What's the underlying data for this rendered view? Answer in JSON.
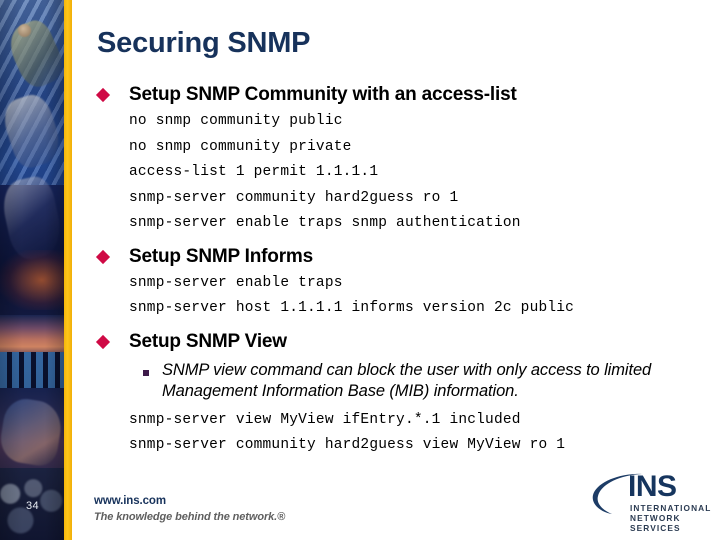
{
  "slide": {
    "title": "Securing SNMP",
    "page_number": "34"
  },
  "colors": {
    "title_navy": "#17325b",
    "bullet_crimson": "#cf0a45",
    "subbullet_purple": "#3d1a4a",
    "gold_stripe": "#ffc61a",
    "logo_navy": "#16355e"
  },
  "sections": [
    {
      "heading": "Setup SNMP Community with an access-list",
      "code": [
        "no snmp community public",
        "no snmp community private",
        "access-list 1 permit 1.1.1.1",
        "snmp-server community hard2guess ro 1",
        "snmp-server enable traps snmp authentication"
      ]
    },
    {
      "heading": "Setup SNMP Informs",
      "code": [
        "snmp-server enable traps",
        "snmp-server host 1.1.1.1 informs version 2c public"
      ]
    },
    {
      "heading": "Setup SNMP View",
      "subbullet": "SNMP view command can block the user with only access to limited Management Information Base (MIB) information.",
      "code": [
        "snmp-server view MyView ifEntry.*.1 included",
        "snmp-server community hard2guess view MyView ro 1"
      ]
    }
  ],
  "footer": {
    "url": "www.ins.com",
    "tagline": "The knowledge behind the network.®"
  },
  "logo": {
    "wordmark": "INS",
    "line1": "INTERNATIONAL",
    "line2": "NETWORK SERVICES"
  }
}
